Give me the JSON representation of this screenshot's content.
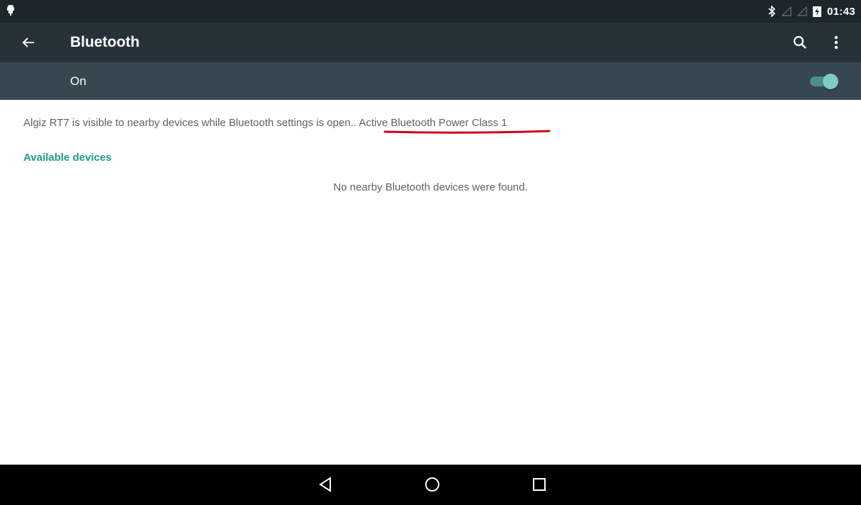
{
  "status_bar": {
    "clock": "01:43",
    "icons": [
      "android-notification-icon",
      "bluetooth-icon",
      "signal-icon",
      "signal-icon",
      "battery-charging-icon"
    ]
  },
  "toolbar": {
    "title": "Bluetooth",
    "back_icon": "arrow-left-icon",
    "search_icon": "search-icon",
    "more_icon": "more-vert-icon"
  },
  "switch_bar": {
    "label": "On",
    "state": "on"
  },
  "visibility": {
    "text": "Algiz RT7 is visible to nearby devices while Bluetooth settings is open.. ",
    "power_class": "Active Bluetooth Power Class 1"
  },
  "available_devices": {
    "header": "Available devices",
    "empty_message": "No nearby Bluetooth devices were found."
  },
  "nav_bar": {
    "buttons": [
      "back-triangle-icon",
      "home-circle-icon",
      "recents-square-icon"
    ]
  },
  "colors": {
    "status_bar": "#1c262b",
    "toolbar": "#263238",
    "switch_bar": "#37474f",
    "accent": "#1f9a8c",
    "toggle_thumb": "#80cbc4",
    "annotation_underline": "#d0021b"
  }
}
